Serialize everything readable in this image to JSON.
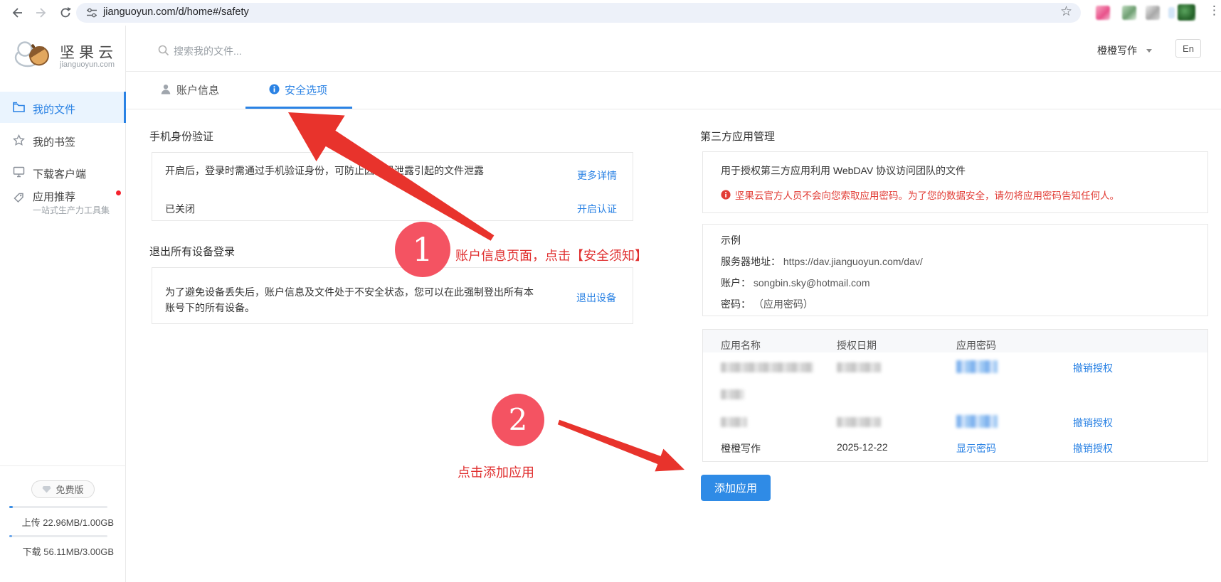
{
  "browser": {
    "url": "jianguoyun.com/d/home#/safety"
  },
  "sidebar": {
    "logo_title": "坚果云",
    "logo_domain": "jianguoyun.com",
    "items": [
      {
        "label": "我的文件",
        "active": true
      },
      {
        "label": "我的书签",
        "active": false
      },
      {
        "label": "下载客户端",
        "active": false
      },
      {
        "label": "应用推荐",
        "sub": "一站式生产力工具集",
        "active": false,
        "badge_dot": true
      }
    ],
    "plan_badge": "免费版",
    "upload_quota": "上传 22.96MB/1.00GB",
    "download_quota": "下载 56.11MB/3.00GB"
  },
  "header": {
    "search_placeholder": "搜索我的文件...",
    "user_name": "橙橙写作",
    "lang_label": "En"
  },
  "tabs": {
    "account": "账户信息",
    "security": "安全选项"
  },
  "left": {
    "phone": {
      "title": "手机身份验证",
      "desc": "开启后，登录时需通过手机验证身份，可防止因密码泄露引起的文件泄露",
      "more_link": "更多详情",
      "status": "已关闭",
      "enable_link": "开启认证"
    },
    "logout": {
      "title": "退出所有设备登录",
      "desc_line1": "为了避免设备丢失后，账户信息及文件处于不安全状态，您可以在此强制登出所有本",
      "desc_line2": "账号下的所有设备。",
      "action_link": "退出设备"
    }
  },
  "right": {
    "section_title": "第三方应用管理",
    "webdav_desc": "用于授权第三方应用利用 WebDAV 协议访问团队的文件",
    "warning": "坚果云官方人员不会向您索取应用密码。为了您的数据安全，请勿将应用密码告知任何人。",
    "example": {
      "title": "示例",
      "server_label": "服务器地址：",
      "server_value": "https://dav.jianguoyun.com/dav/",
      "account_label": "账户：",
      "account_value": "songbin.sky@hotmail.com",
      "password_label": "密码：",
      "password_value": "（应用密码）"
    },
    "table": {
      "headers": [
        "应用名称",
        "授权日期",
        "应用密码"
      ],
      "rows": [
        {
          "name_redacted": true,
          "date_redacted": true,
          "password_redacted": true,
          "action": "撤销授权"
        },
        {
          "name_redacted": true,
          "date_redacted": true,
          "password_redacted": true,
          "action": "撤销授权"
        },
        {
          "name": "橙橙写作",
          "date": "2025-12-22",
          "password_link": "显示密码",
          "action": "撤销授权"
        }
      ]
    },
    "add_button": "添加应用"
  },
  "annotations": {
    "step1": {
      "number": "1",
      "text": "账户信息页面，点击【安全须知】"
    },
    "step2": {
      "number": "2",
      "text": "点击添加应用"
    }
  },
  "colors": {
    "accent_blue": "#2a82e4",
    "button_blue": "#2f8be6",
    "annotation_arrow_red": "#e8332c",
    "annotation_circle_red": "#f45362",
    "annotation_text_red": "#e03030",
    "warning_red": "#e23d36"
  }
}
